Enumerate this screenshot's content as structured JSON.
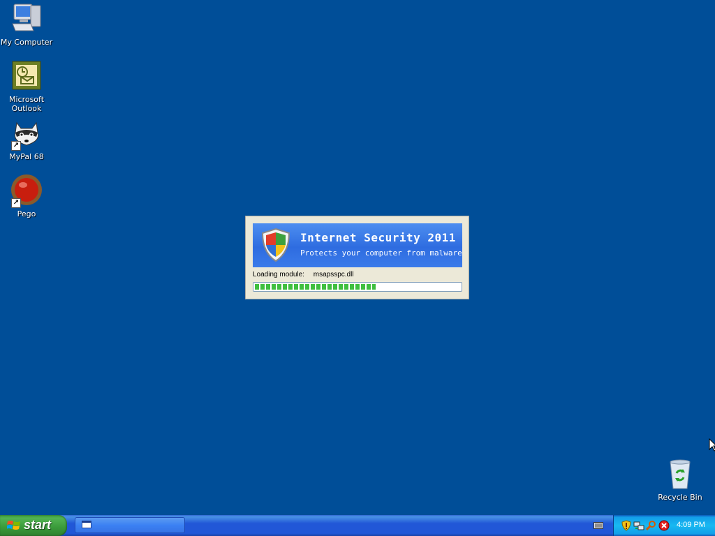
{
  "desktop": {
    "icons": [
      {
        "label": "My Computer"
      },
      {
        "label": "Microsoft Outlook"
      },
      {
        "label": "MyPal 68"
      },
      {
        "label": "Pego"
      }
    ],
    "recycle_bin": {
      "label": "Recycle Bin"
    }
  },
  "splash": {
    "title": "Internet Security 2011",
    "subtitle": "Protects your computer from malware",
    "loading_label": "Loading module:",
    "module_name": "msapsspc.dll",
    "progress_percent": 59
  },
  "taskbar": {
    "start_label": "start",
    "clock": "4:09 PM"
  },
  "colors": {
    "desktop_bg": "#004e98",
    "banner_blue": "#3b7bea",
    "progress_green": "#3fbf3f",
    "start_green": "#3a9a3a"
  },
  "tray_icons": [
    "security-shield-icon",
    "network-icon",
    "search-icon",
    "security-alert-icon"
  ]
}
